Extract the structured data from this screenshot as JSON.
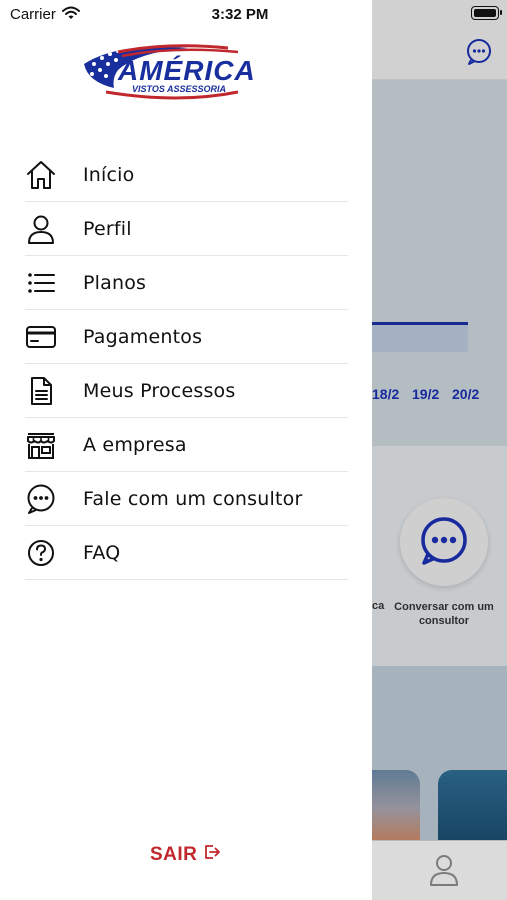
{
  "status_bar": {
    "carrier": "Carrier",
    "time": "3:32 PM"
  },
  "brand": {
    "name": "AMÉRICA",
    "tagline": "VISTOS ASSESSORIA",
    "colors": {
      "blue": "#1a2f9e",
      "red": "#c0282d"
    }
  },
  "menu": {
    "items": [
      {
        "label": "Início",
        "icon": "home-icon"
      },
      {
        "label": "Perfil",
        "icon": "user-icon"
      },
      {
        "label": "Planos",
        "icon": "list-icon"
      },
      {
        "label": "Pagamentos",
        "icon": "credit-card-icon"
      },
      {
        "label": "Meus Processos",
        "icon": "document-icon"
      },
      {
        "label": "A empresa",
        "icon": "store-icon"
      },
      {
        "label": "Fale com um consultor",
        "icon": "chat-icon"
      },
      {
        "label": "FAQ",
        "icon": "help-circle-icon"
      }
    ]
  },
  "logout": {
    "label": "SAIR",
    "icon": "logout-icon"
  },
  "background": {
    "chart_dates": [
      "18/2",
      "19/2",
      "20/2"
    ],
    "cut_label": "ca",
    "chat_caption": "Conversar com um consultor",
    "accent": "#1a2fb0"
  }
}
